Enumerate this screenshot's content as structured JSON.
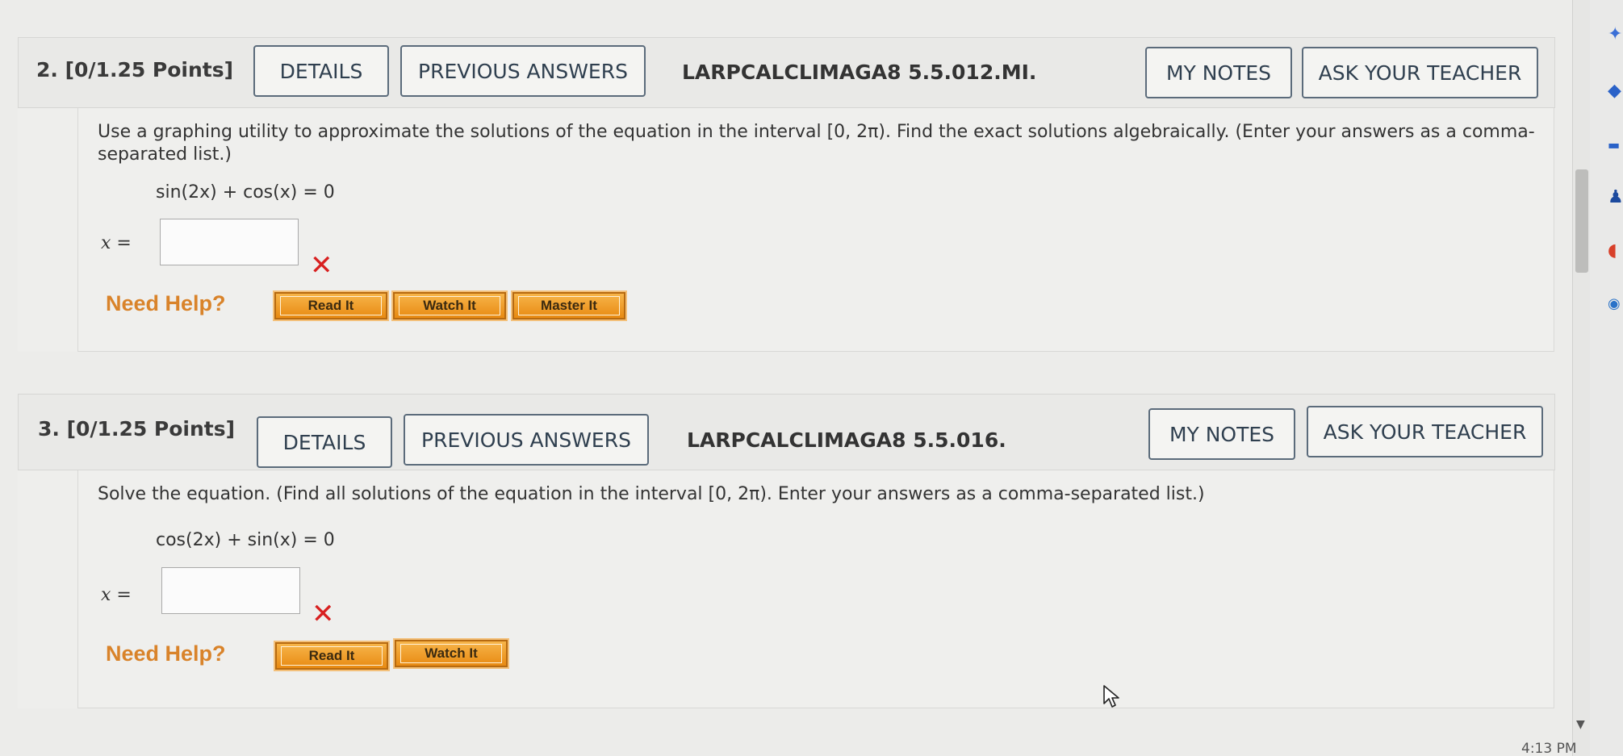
{
  "questions": [
    {
      "number_points": "2.  [0/1.25 Points]",
      "details_label": "DETAILS",
      "previous_answers_label": "PREVIOUS ANSWERS",
      "code": "LARPCALCLIMAGA8 5.5.012.MI.",
      "my_notes_label": "MY NOTES",
      "ask_teacher_label": "ASK YOUR TEACHER",
      "prompt_line1": "Use a graphing utility to approximate the solutions of the equation in the interval [0, 2π). Find the exact solutions algebraically. (Enter your answers as a comma-",
      "prompt_line2": "separated list.)",
      "equation": "sin(2x) + cos(x) = 0",
      "answer_label": "x =",
      "answer_value": "",
      "status_mark": "✕",
      "need_help": "Need Help?",
      "help_buttons": [
        "Read It",
        "Watch It",
        "Master It"
      ]
    },
    {
      "number_points": "3.  [0/1.25 Points]",
      "details_label": "DETAILS",
      "previous_answers_label": "PREVIOUS ANSWERS",
      "code": "LARPCALCLIMAGA8 5.5.016.",
      "my_notes_label": "MY NOTES",
      "ask_teacher_label": "ASK YOUR TEACHER",
      "prompt_line1": "Solve the equation. (Find all solutions of the equation in the interval [0, 2π). Enter your answers as a comma-separated list.)",
      "equation": "cos(2x) + sin(x) = 0",
      "answer_label": "x =",
      "answer_value": "",
      "status_mark": "✕",
      "need_help": "Need Help?",
      "help_buttons": [
        "Read It",
        "Watch It"
      ]
    }
  ],
  "system": {
    "clock": "4:13 PM"
  },
  "colors": {
    "need_help": "#d9832a",
    "wrong_mark": "#d82020",
    "button_border": "#5b6b7b"
  }
}
